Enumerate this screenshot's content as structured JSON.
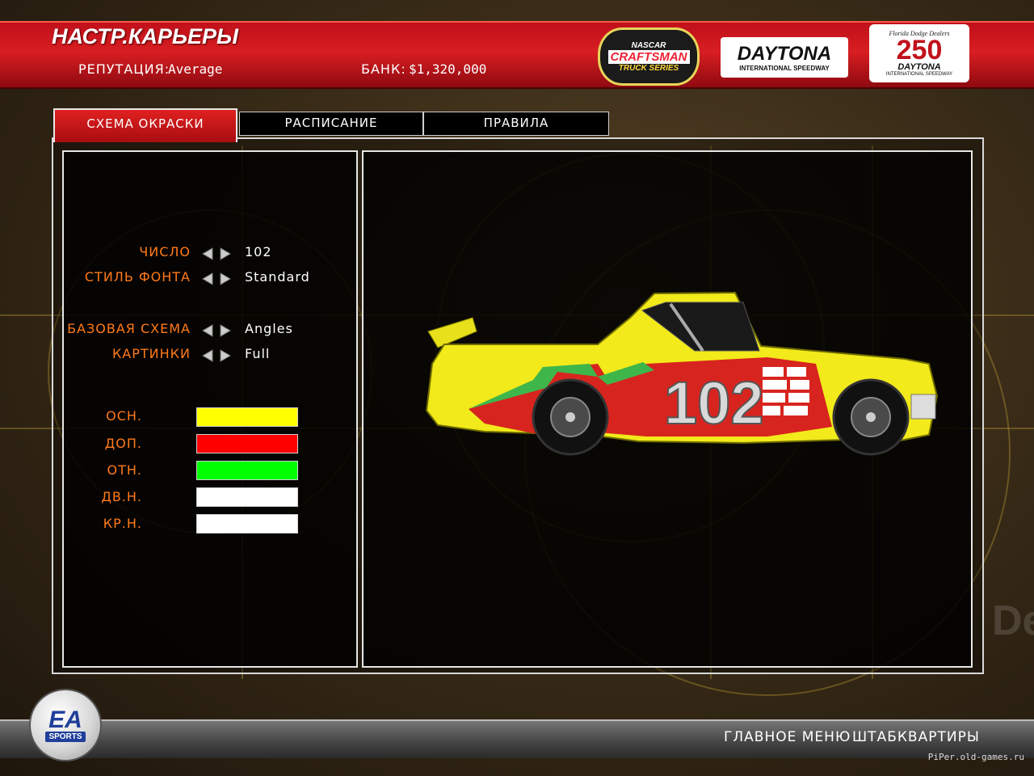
{
  "header": {
    "title": "НАСТР.КАРЬЕРЫ",
    "reputation_label": "РЕПУТАЦИЯ:",
    "reputation_value": "Average",
    "bank_label": "БАНК:",
    "bank_value": "$1,320,000"
  },
  "logos": {
    "nascar": {
      "line1": "NASCAR",
      "line2": "CRAFTSMAN",
      "line3": "TRUCK SERIES"
    },
    "daytona": {
      "line1": "DAYTONA",
      "line2": "INTERNATIONAL SPEEDWAY"
    },
    "daytona250": {
      "line0": "Florida Dodge Dealers",
      "line1": "250",
      "line2": "DAYTONA",
      "line3": "INTERNATIONAL SPEEDWAY"
    },
    "ea": {
      "line1": "EA",
      "line2": "SPORTS"
    }
  },
  "tabs": [
    {
      "label": "СХЕМА ОКРАСКИ",
      "active": true
    },
    {
      "label": "РАСПИСАНИЕ",
      "active": false
    },
    {
      "label": "ПРАВИЛА",
      "active": false
    }
  ],
  "options": [
    {
      "label": "ЧИСЛО",
      "value": "102"
    },
    {
      "label": "СТИЛЬ ФОНТА",
      "value": "Standard"
    },
    {
      "label": "БАЗОВАЯ СХЕМА",
      "value": "Angles"
    },
    {
      "label": "КАРТИНКИ",
      "value": "Full"
    }
  ],
  "colors": [
    {
      "label": "ОСН.",
      "hex": "#ffff00"
    },
    {
      "label": "ДОП.",
      "hex": "#ff0000"
    },
    {
      "label": "ОТН.",
      "hex": "#00ff00"
    },
    {
      "label": "ДВ.Н.",
      "hex": "#ffffff"
    },
    {
      "label": "КР.Н.",
      "hex": "#ffffff"
    }
  ],
  "truck": {
    "number": "102",
    "body_color": "#f2ea1a",
    "stripe_color": "#d8241e",
    "accent_color": "#3fb64a"
  },
  "footer": {
    "main_menu": "ГЛАВНОЕ МЕНЮ",
    "hq": "ШТАБКВАРТИРЫ",
    "watermark": "PiPer.old-games.ru"
  },
  "decor": {
    "de_text": "De"
  }
}
